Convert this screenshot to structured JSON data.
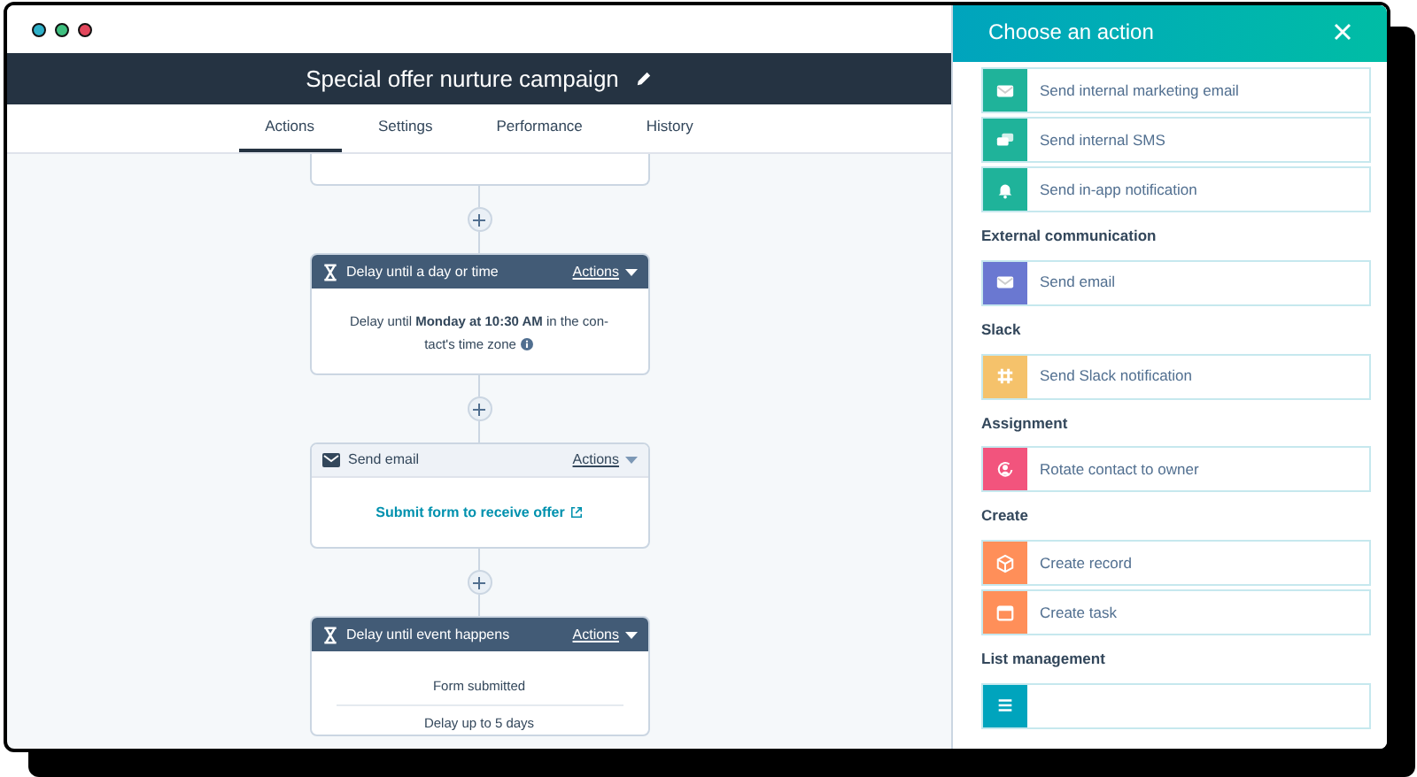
{
  "window": {
    "title": "Special offer nurture campaign"
  },
  "tabs": [
    {
      "label": "Actions",
      "selected": true
    },
    {
      "label": "Settings",
      "selected": false
    },
    {
      "label": "Performance",
      "selected": false
    },
    {
      "label": "History",
      "selected": false
    }
  ],
  "workflow": [
    {
      "kind": "stub"
    },
    {
      "kind": "delay",
      "title": "Delay until a day or time",
      "actions": "Actions",
      "body": [
        "Delay until **Monday at 10:30 AM** in the con-",
        "tact's time zone"
      ]
    },
    {
      "kind": "email",
      "title": "Send email",
      "actions": "Actions",
      "link": "Submit form to receive offer"
    },
    {
      "kind": "event",
      "title": "Delay until event happens",
      "actions": "Actions",
      "lines": [
        "Form submitted",
        "Delay up to 5 days"
      ]
    }
  ],
  "panel": {
    "title": "Choose an action",
    "sections": [
      {
        "items": [
          {
            "label": "Send internal marketing email",
            "kind": "mail",
            "color": "#1fb39a"
          },
          {
            "label": "Send internal SMS",
            "kind": "sms",
            "color": "#1fb39a"
          },
          {
            "label": "Send in-app notification",
            "kind": "bell",
            "color": "#1fb39a"
          }
        ]
      },
      {
        "heading": "External communication",
        "items": [
          {
            "label": "Send email",
            "kind": "mail",
            "color": "#6a78d1"
          }
        ]
      },
      {
        "heading": "Slack",
        "items": [
          {
            "label": "Send Slack notification",
            "kind": "slack",
            "color": "#f5c26b"
          }
        ]
      },
      {
        "heading": "Assignment",
        "items": [
          {
            "label": "Rotate contact to owner",
            "kind": "rotate",
            "color": "#f2547d"
          }
        ]
      },
      {
        "heading": "Create",
        "items": [
          {
            "label": "Create record",
            "kind": "box",
            "color": "#ff8f59"
          },
          {
            "label": "Create task",
            "kind": "task",
            "color": "#ff8f59"
          }
        ]
      },
      {
        "heading": "List management",
        "items": [
          {
            "kind": "list",
            "color": "#00a4bd"
          }
        ]
      }
    ]
  }
}
